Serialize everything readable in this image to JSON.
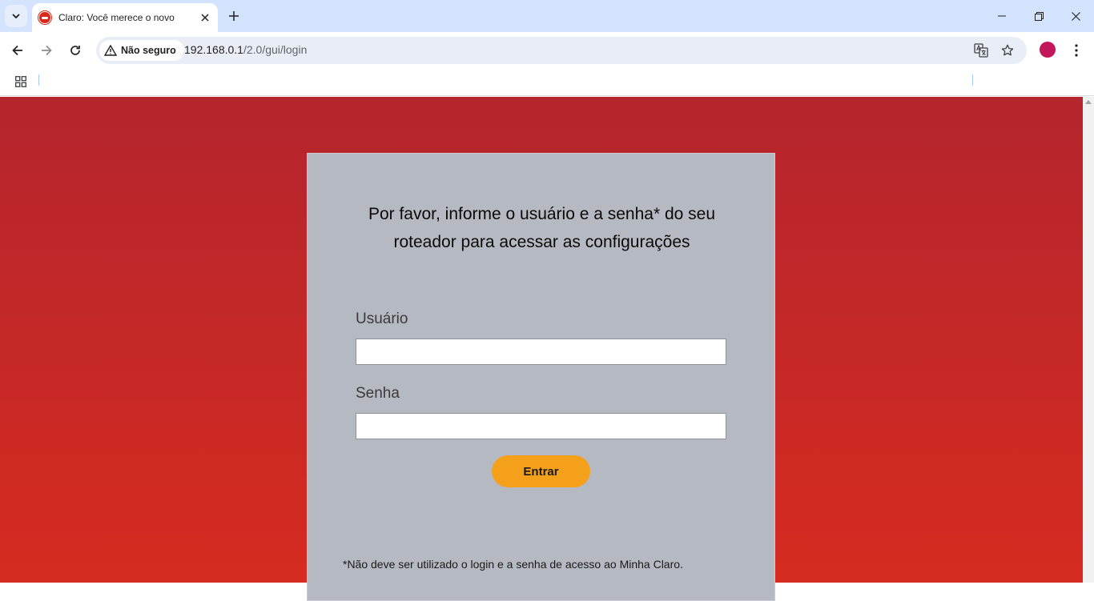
{
  "browser": {
    "tab_title": "Claro: Você merece o novo",
    "security_label": "Não seguro",
    "url_host": "192.168.0.1",
    "url_path": "/2.0/gui/login"
  },
  "login": {
    "heading": "Por favor, informe o usuário e a senha* do seu roteador para acessar as configurações",
    "username_label": "Usuário",
    "username_value": "",
    "password_label": "Senha",
    "password_value": "",
    "submit_label": "Entrar",
    "footnote": "*Não deve ser utilizado o login e a senha de acesso ao Minha Claro."
  },
  "colors": {
    "page_top": "#b4252e",
    "page_bottom": "#d62b20",
    "card_bg": "#b5b9c1",
    "button": "#f5a01a",
    "profile": "#c2185b"
  }
}
